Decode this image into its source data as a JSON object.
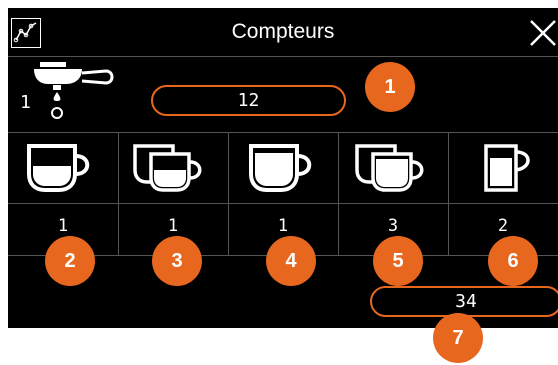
{
  "header": {
    "title": "Compteurs",
    "stats_icon": "line-chart-icon",
    "close_icon": "close-icon"
  },
  "group_counter": {
    "icon": "brewing-group-icon",
    "group_number": "1",
    "value": "12"
  },
  "drinks": [
    {
      "icon": "small-cup-icon",
      "count": "1"
    },
    {
      "icon": "double-small-cup-icon",
      "count": "1"
    },
    {
      "icon": "large-cup-icon",
      "count": "1"
    },
    {
      "icon": "double-large-cup-icon",
      "count": "3"
    },
    {
      "icon": "pitcher-icon",
      "count": "2"
    }
  ],
  "total": {
    "value": "34"
  },
  "callouts": [
    "1",
    "2",
    "3",
    "4",
    "5",
    "6",
    "7"
  ],
  "colors": {
    "accent": "#e8671f",
    "background": "#000000",
    "text": "#ffffff"
  }
}
